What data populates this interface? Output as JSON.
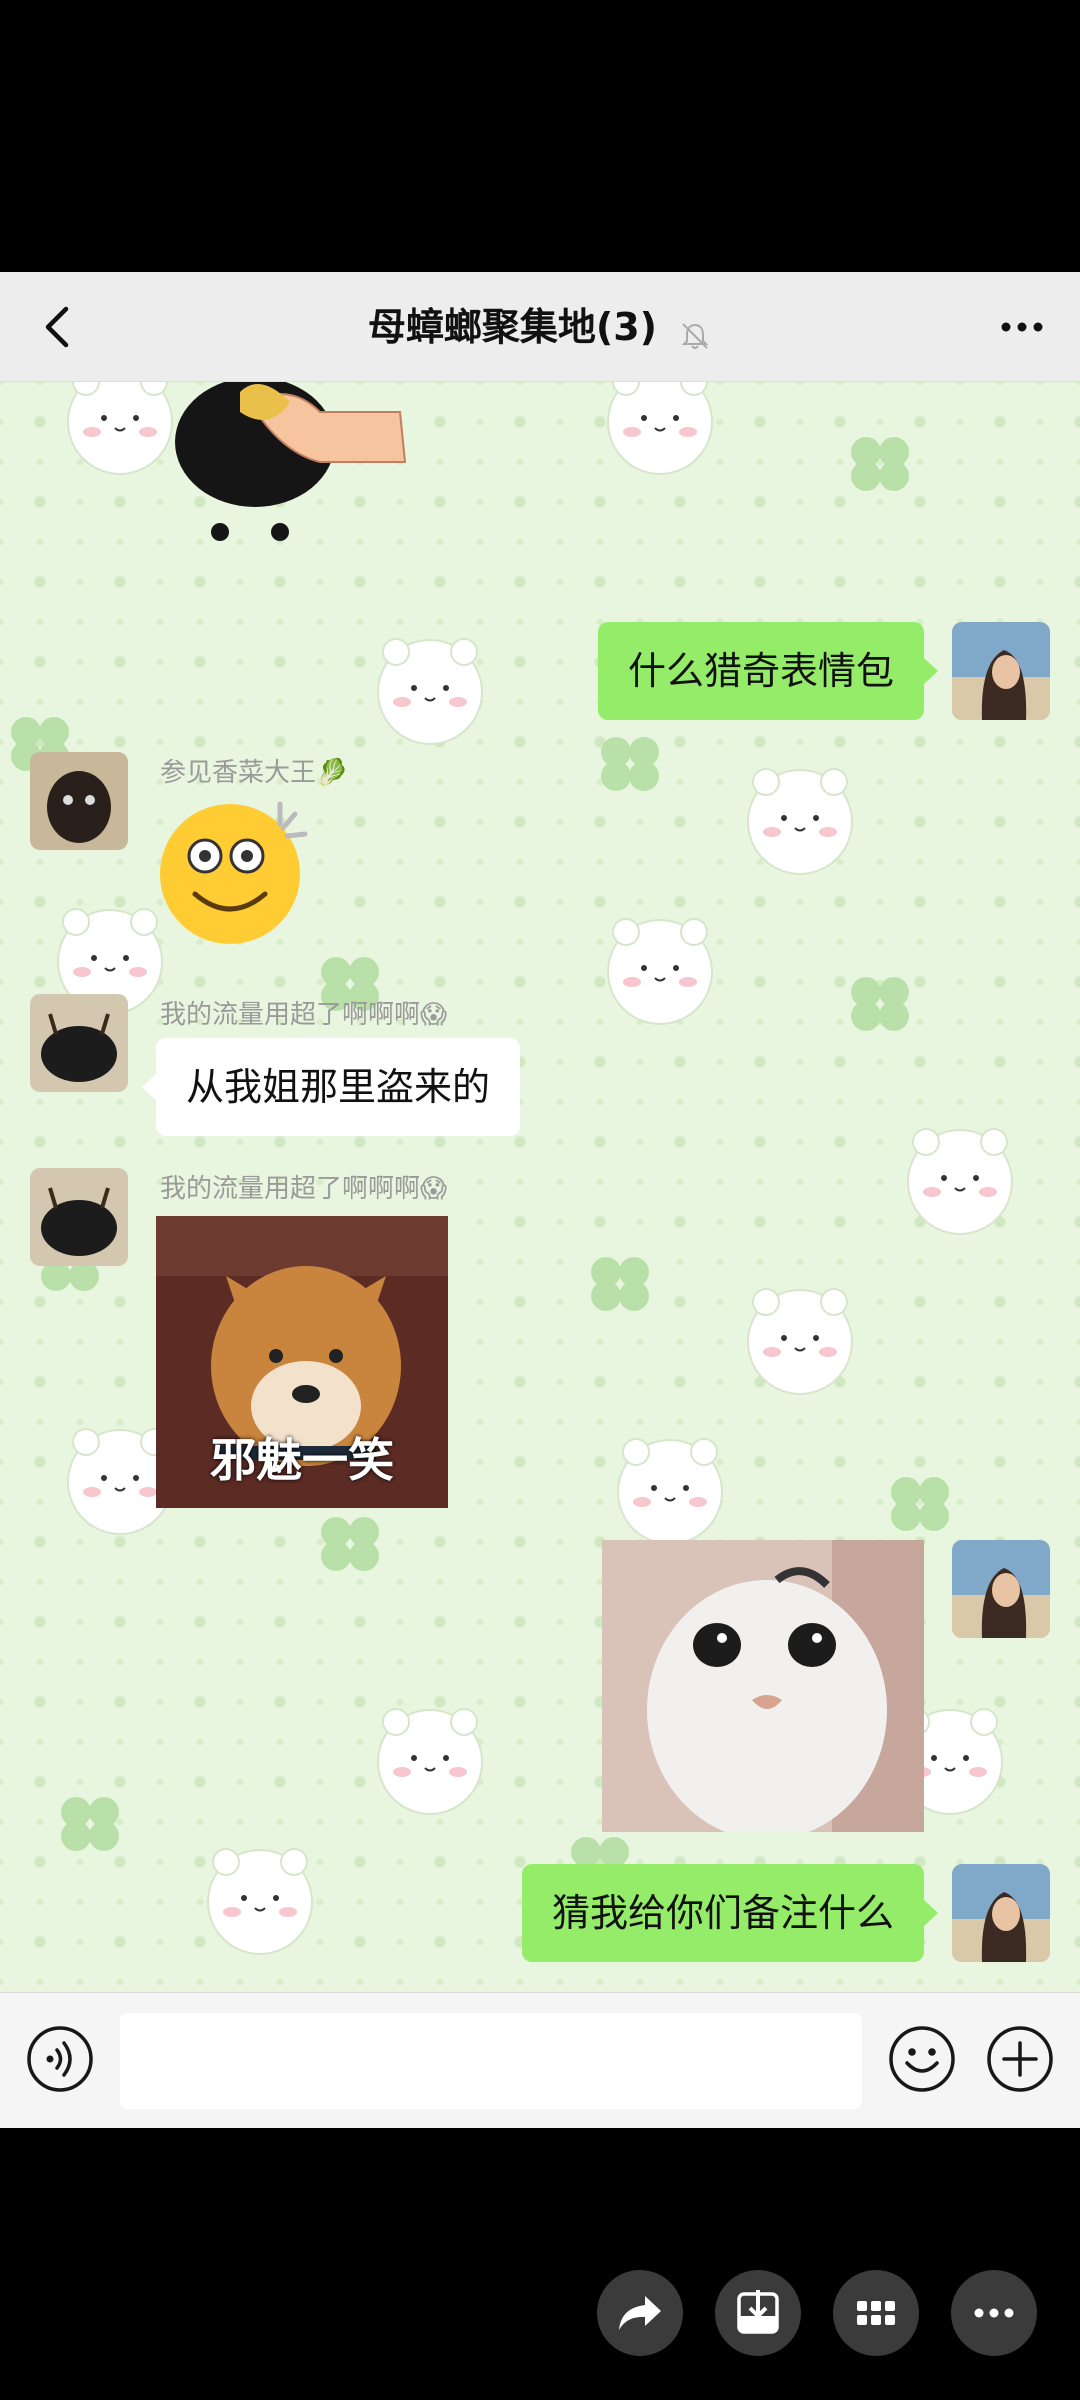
{
  "header": {
    "title": "母蟑螂聚集地(3)",
    "back_icon": "chevron-left-icon",
    "mute_icon": "bell-off-icon",
    "more_icon": "more-dots-icon"
  },
  "messages": [
    {
      "type": "sticker",
      "side": "in",
      "description": "black blob being patted by a hand"
    },
    {
      "type": "text",
      "side": "out",
      "text": "什么猎奇表情包"
    },
    {
      "type": "sticker",
      "side": "in",
      "sender": "参见香菜大王🥬",
      "description": "dizzy smiling face emoji"
    },
    {
      "type": "text",
      "side": "in",
      "sender": "我的流量用超了啊啊啊😱",
      "text": "从我姐那里盗来的"
    },
    {
      "type": "image",
      "side": "in",
      "sender": "我的流量用超了啊啊啊😱",
      "caption": "邪魅一笑"
    },
    {
      "type": "image",
      "side": "out",
      "description": "white cat with big eyes"
    },
    {
      "type": "text",
      "side": "out",
      "text": "猜我给你们备注什么"
    }
  ],
  "input": {
    "placeholder": "",
    "voice_icon": "voice-icon",
    "emoji_icon": "emoji-icon",
    "plus_icon": "plus-icon"
  },
  "actions": {
    "share_icon": "share-icon",
    "download_icon": "download-icon",
    "grid_icon": "grid-icon",
    "more_icon": "more-dots-icon"
  },
  "colors": {
    "out_bubble": "#95ec69",
    "in_bubble": "#ffffff",
    "chat_bg": "#e9f6df",
    "header_bg": "#ededed"
  }
}
